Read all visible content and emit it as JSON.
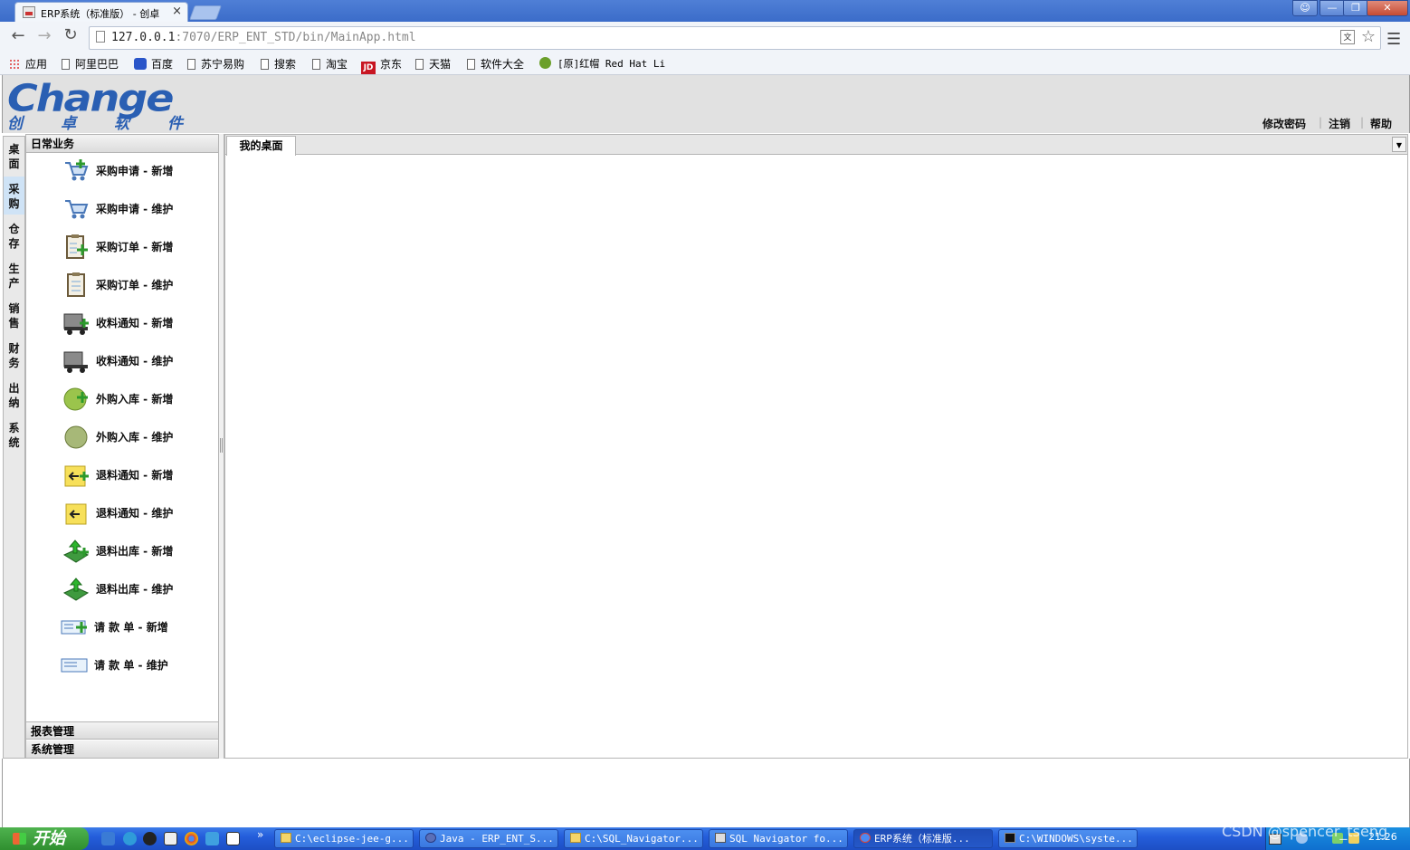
{
  "browser": {
    "tab_title": "ERP系统（标准版） - 创卓",
    "tab_close": "×",
    "url_host": "127.0.0.1",
    "url_path": ":7070/ERP_ENT_STD/bin/MainApp.html",
    "bookmarks": [
      "应用",
      "阿里巴巴",
      "百度",
      "苏宁易购",
      "搜索",
      "淘宝",
      "京东",
      "天猫",
      "软件大全",
      "[原]红帽 Red Hat Li"
    ],
    "jd_badge": "JD"
  },
  "app": {
    "logo_word": "Change",
    "logo_cn": "创卓软件",
    "top_links": [
      "修改密码",
      "注销",
      "帮助"
    ],
    "vnav": [
      "桌面",
      "采购",
      "仓存",
      "生产",
      "销售",
      "财务",
      "出纳",
      "系统"
    ],
    "vnav_active": "采购",
    "accordion": {
      "open_section": "日常业务",
      "items": [
        "采购申请 - 新增",
        "采购申请 - 维护",
        "采购订单 - 新增",
        "采购订单 - 维护",
        "收料通知 - 新增",
        "收料通知 - 维护",
        "外购入库 - 新增",
        "外购入库 - 维护",
        "退料通知 - 新增",
        "退料通知 - 维护",
        "退料出库 - 新增",
        "退料出库 - 维护",
        "请 款 单 - 新增",
        "请 款 单 - 维护"
      ],
      "collapsed_sections": [
        "报表管理",
        "系统管理"
      ]
    },
    "content_tab": "我的桌面"
  },
  "taskbar": {
    "start": "开始",
    "tasks": [
      "C:\\eclipse-jee-g...",
      "Java - ERP_ENT_S...",
      "C:\\SQL_Navigator...",
      "SQL Navigator fo...",
      "ERP系统（标准版...",
      "C:\\WINDOWS\\syste..."
    ],
    "active_task_index": 4,
    "clock": "21:26",
    "watermark": "CSDN @spencer_tseng"
  },
  "colors": {
    "brand": "#2a5fb3",
    "taskbar": "#245edb",
    "start": "#3a9a3a"
  }
}
